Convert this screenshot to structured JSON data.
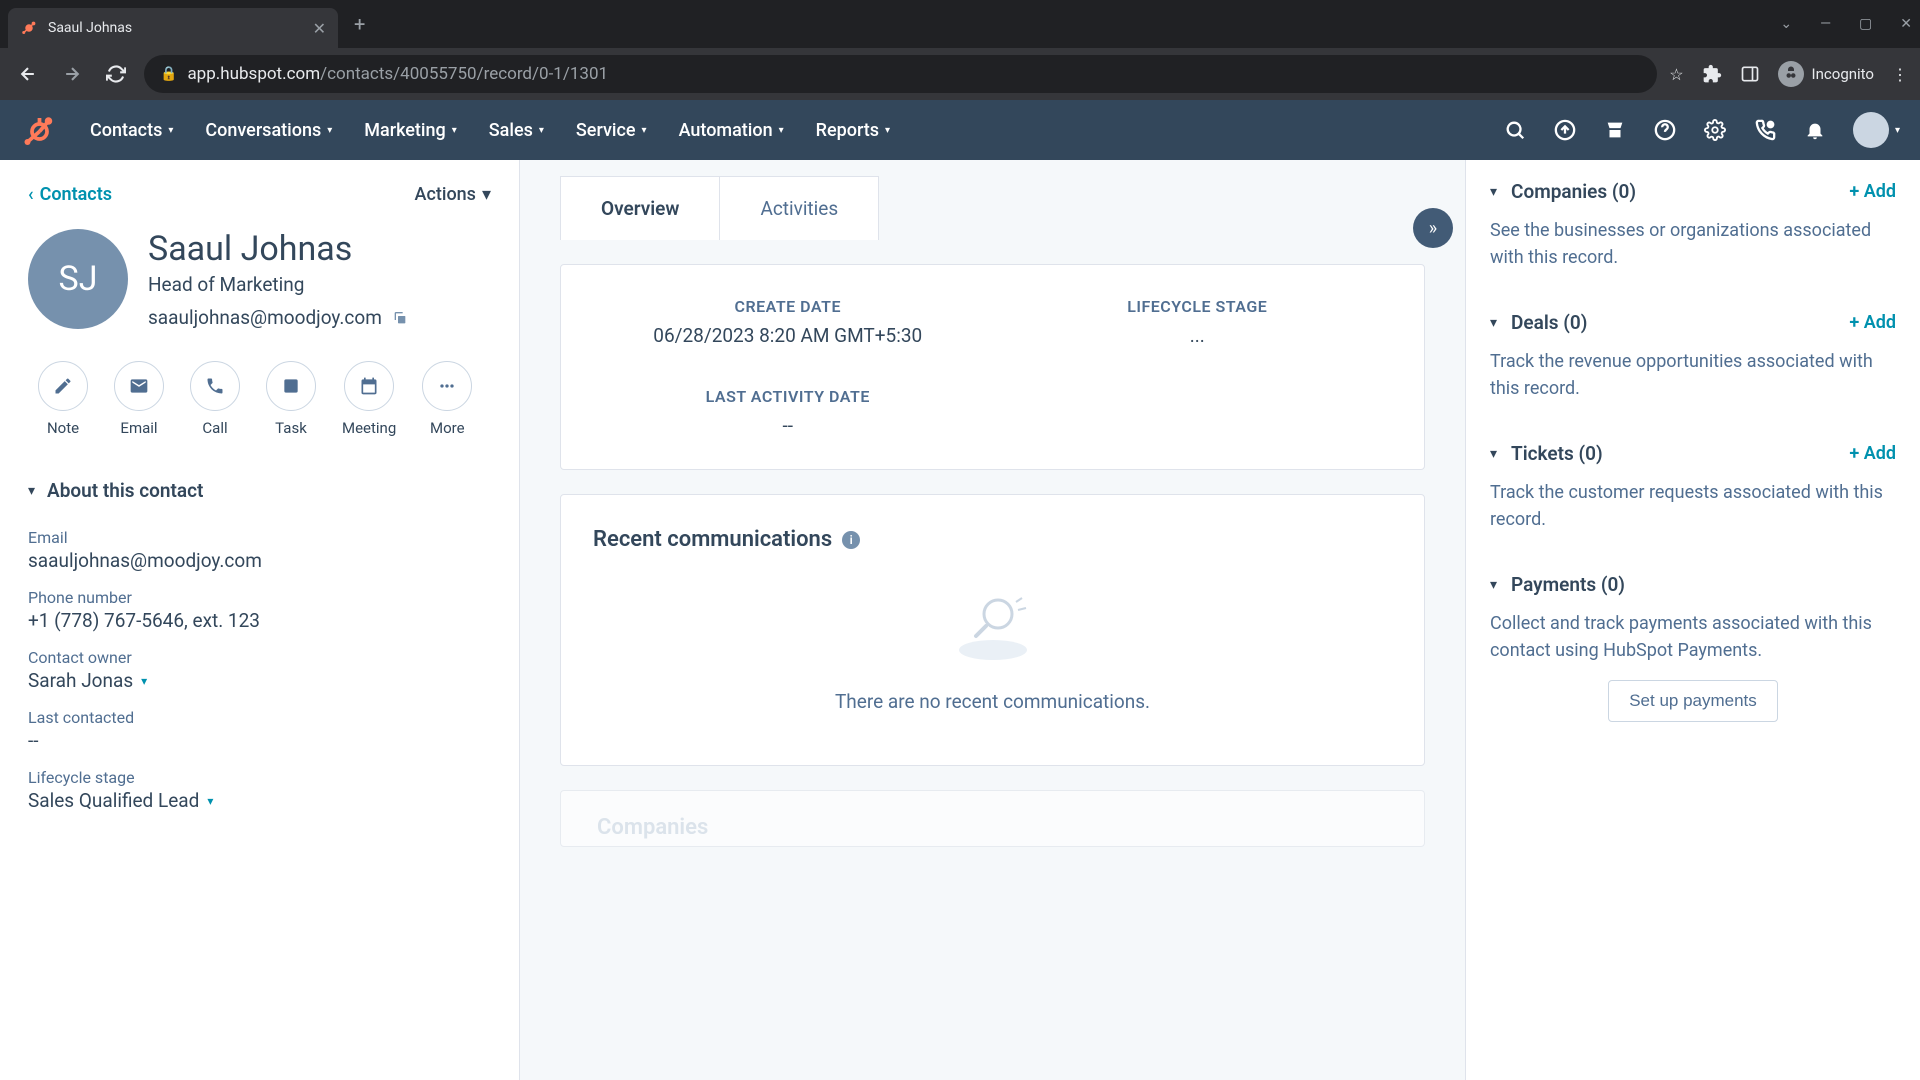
{
  "browser": {
    "tab_title": "Saaul Johnas",
    "url_domain": "app.hubspot.com",
    "url_path": "/contacts/40055750/record/0-1/1301",
    "incognito_label": "Incognito"
  },
  "nav": {
    "items": [
      "Contacts",
      "Conversations",
      "Marketing",
      "Sales",
      "Service",
      "Automation",
      "Reports"
    ]
  },
  "left": {
    "back_label": "Contacts",
    "actions_label": "Actions",
    "avatar_initials": "SJ",
    "name": "Saaul Johnas",
    "job_title": "Head of Marketing",
    "email": "saauljohnas@moodjoy.com",
    "actions": [
      {
        "label": "Note"
      },
      {
        "label": "Email"
      },
      {
        "label": "Call"
      },
      {
        "label": "Task"
      },
      {
        "label": "Meeting"
      },
      {
        "label": "More"
      }
    ],
    "about_title": "About this contact",
    "fields": {
      "email_label": "Email",
      "email_value": "saauljohnas@moodjoy.com",
      "phone_label": "Phone number",
      "phone_value": "+1 (778) 767-5646, ext. 123",
      "owner_label": "Contact owner",
      "owner_value": "Sarah Jonas",
      "last_contacted_label": "Last contacted",
      "last_contacted_value": "--",
      "lifecycle_label": "Lifecycle stage",
      "lifecycle_value": "Sales Qualified Lead"
    }
  },
  "center": {
    "tabs": {
      "overview": "Overview",
      "activities": "Activities"
    },
    "info": {
      "create_date_label": "CREATE DATE",
      "create_date_value": "06/28/2023 8:20 AM GMT+5:30",
      "lifecycle_label": "LIFECYCLE STAGE",
      "lifecycle_value": "...",
      "last_activity_label": "LAST ACTIVITY DATE",
      "last_activity_value": "--"
    },
    "recent_title": "Recent communications",
    "recent_empty": "There are no recent communications.",
    "companies_faded": "Companies"
  },
  "right": {
    "companies": {
      "title": "Companies (0)",
      "add": "+ Add",
      "desc": "See the businesses or organizations associated with this record."
    },
    "deals": {
      "title": "Deals (0)",
      "add": "+ Add",
      "desc": "Track the revenue opportunities associated with this record."
    },
    "tickets": {
      "title": "Tickets (0)",
      "add": "+ Add",
      "desc": "Track the customer requests associated with this record."
    },
    "payments": {
      "title": "Payments (0)",
      "desc": "Collect and track payments associated with this contact using HubSpot Payments.",
      "setup": "Set up payments"
    }
  }
}
